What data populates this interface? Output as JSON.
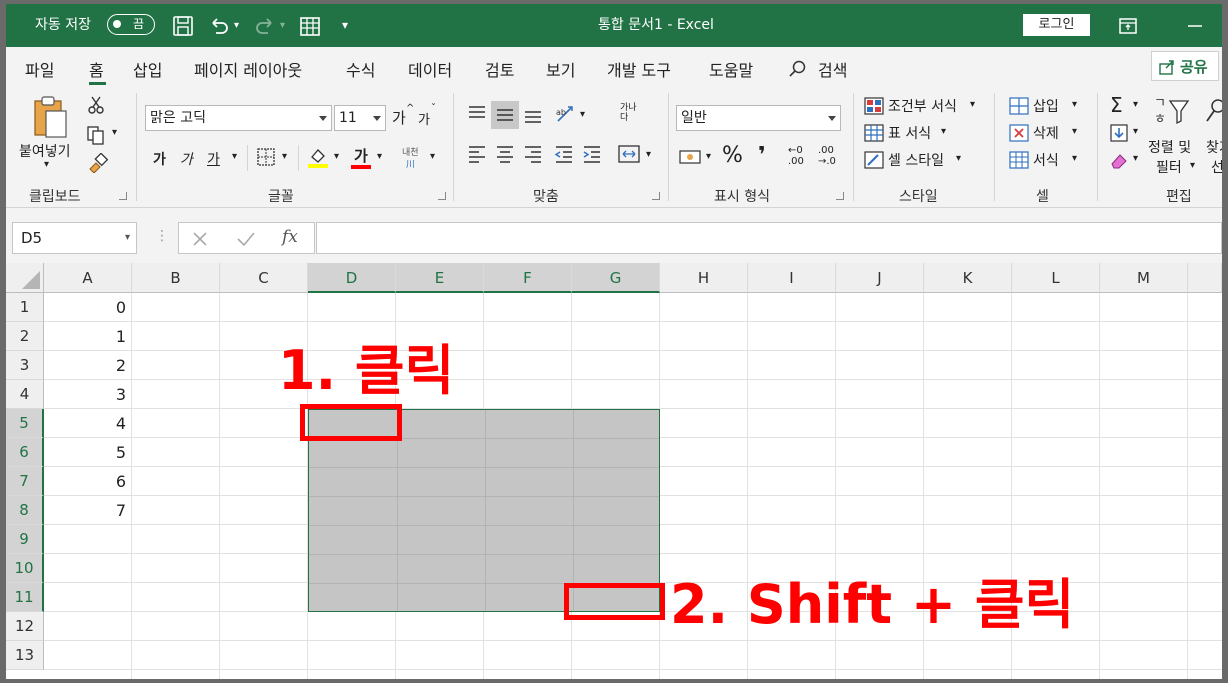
{
  "titlebar": {
    "autosave_label": "자동 저장",
    "autosave_state": "끔",
    "doc_title": "통합 문서1  -  Excel",
    "login": "로그인"
  },
  "tabs": [
    "파일",
    "홈",
    "삽입",
    "페이지 레이아웃",
    "수식",
    "데이터",
    "검토",
    "보기",
    "개발 도구",
    "도움말"
  ],
  "search_label": "검색",
  "share_label": "공유",
  "ribbon": {
    "clipboard": {
      "paste": "붙여넣기",
      "group": "클립보드"
    },
    "font": {
      "name": "맑은 고딕",
      "size": "11",
      "group": "글꼴",
      "bold": "가",
      "italic": "가",
      "underline": "가",
      "fontcolor": "가",
      "phonetic": "내천",
      "grow": "가",
      "shrink": "가"
    },
    "alignment": {
      "group": "맞춤",
      "wrap": "가나다"
    },
    "number": {
      "format": "일반",
      "group": "표시 형식"
    },
    "styles": {
      "conditional": "조건부 서식",
      "table": "표 서식",
      "cell": "셀 스타일",
      "group": "스타일"
    },
    "cells": {
      "insert": "삽입",
      "delete": "삭제",
      "format": "서식",
      "group": "셀"
    },
    "editing": {
      "sort": "정렬 및",
      "filter": "필터",
      "find": "찾기",
      "select": "선",
      "group": "편집"
    }
  },
  "formula_bar": {
    "name_box": "D5",
    "fx": "fx",
    "value": ""
  },
  "columns": [
    "A",
    "B",
    "C",
    "D",
    "E",
    "F",
    "G",
    "H",
    "I",
    "J",
    "K",
    "L",
    "M"
  ],
  "rows": [
    "1",
    "2",
    "3",
    "4",
    "5",
    "6",
    "7",
    "8",
    "9",
    "10",
    "11",
    "12",
    "13"
  ],
  "cells_A": [
    "0",
    "1",
    "2",
    "3",
    "4",
    "5",
    "6",
    "7"
  ],
  "annotations": {
    "step1": "1. 클릭",
    "step2": "2. Shift + 클릭"
  },
  "colors": {
    "accent": "#217346",
    "annotation": "#ff0000"
  }
}
